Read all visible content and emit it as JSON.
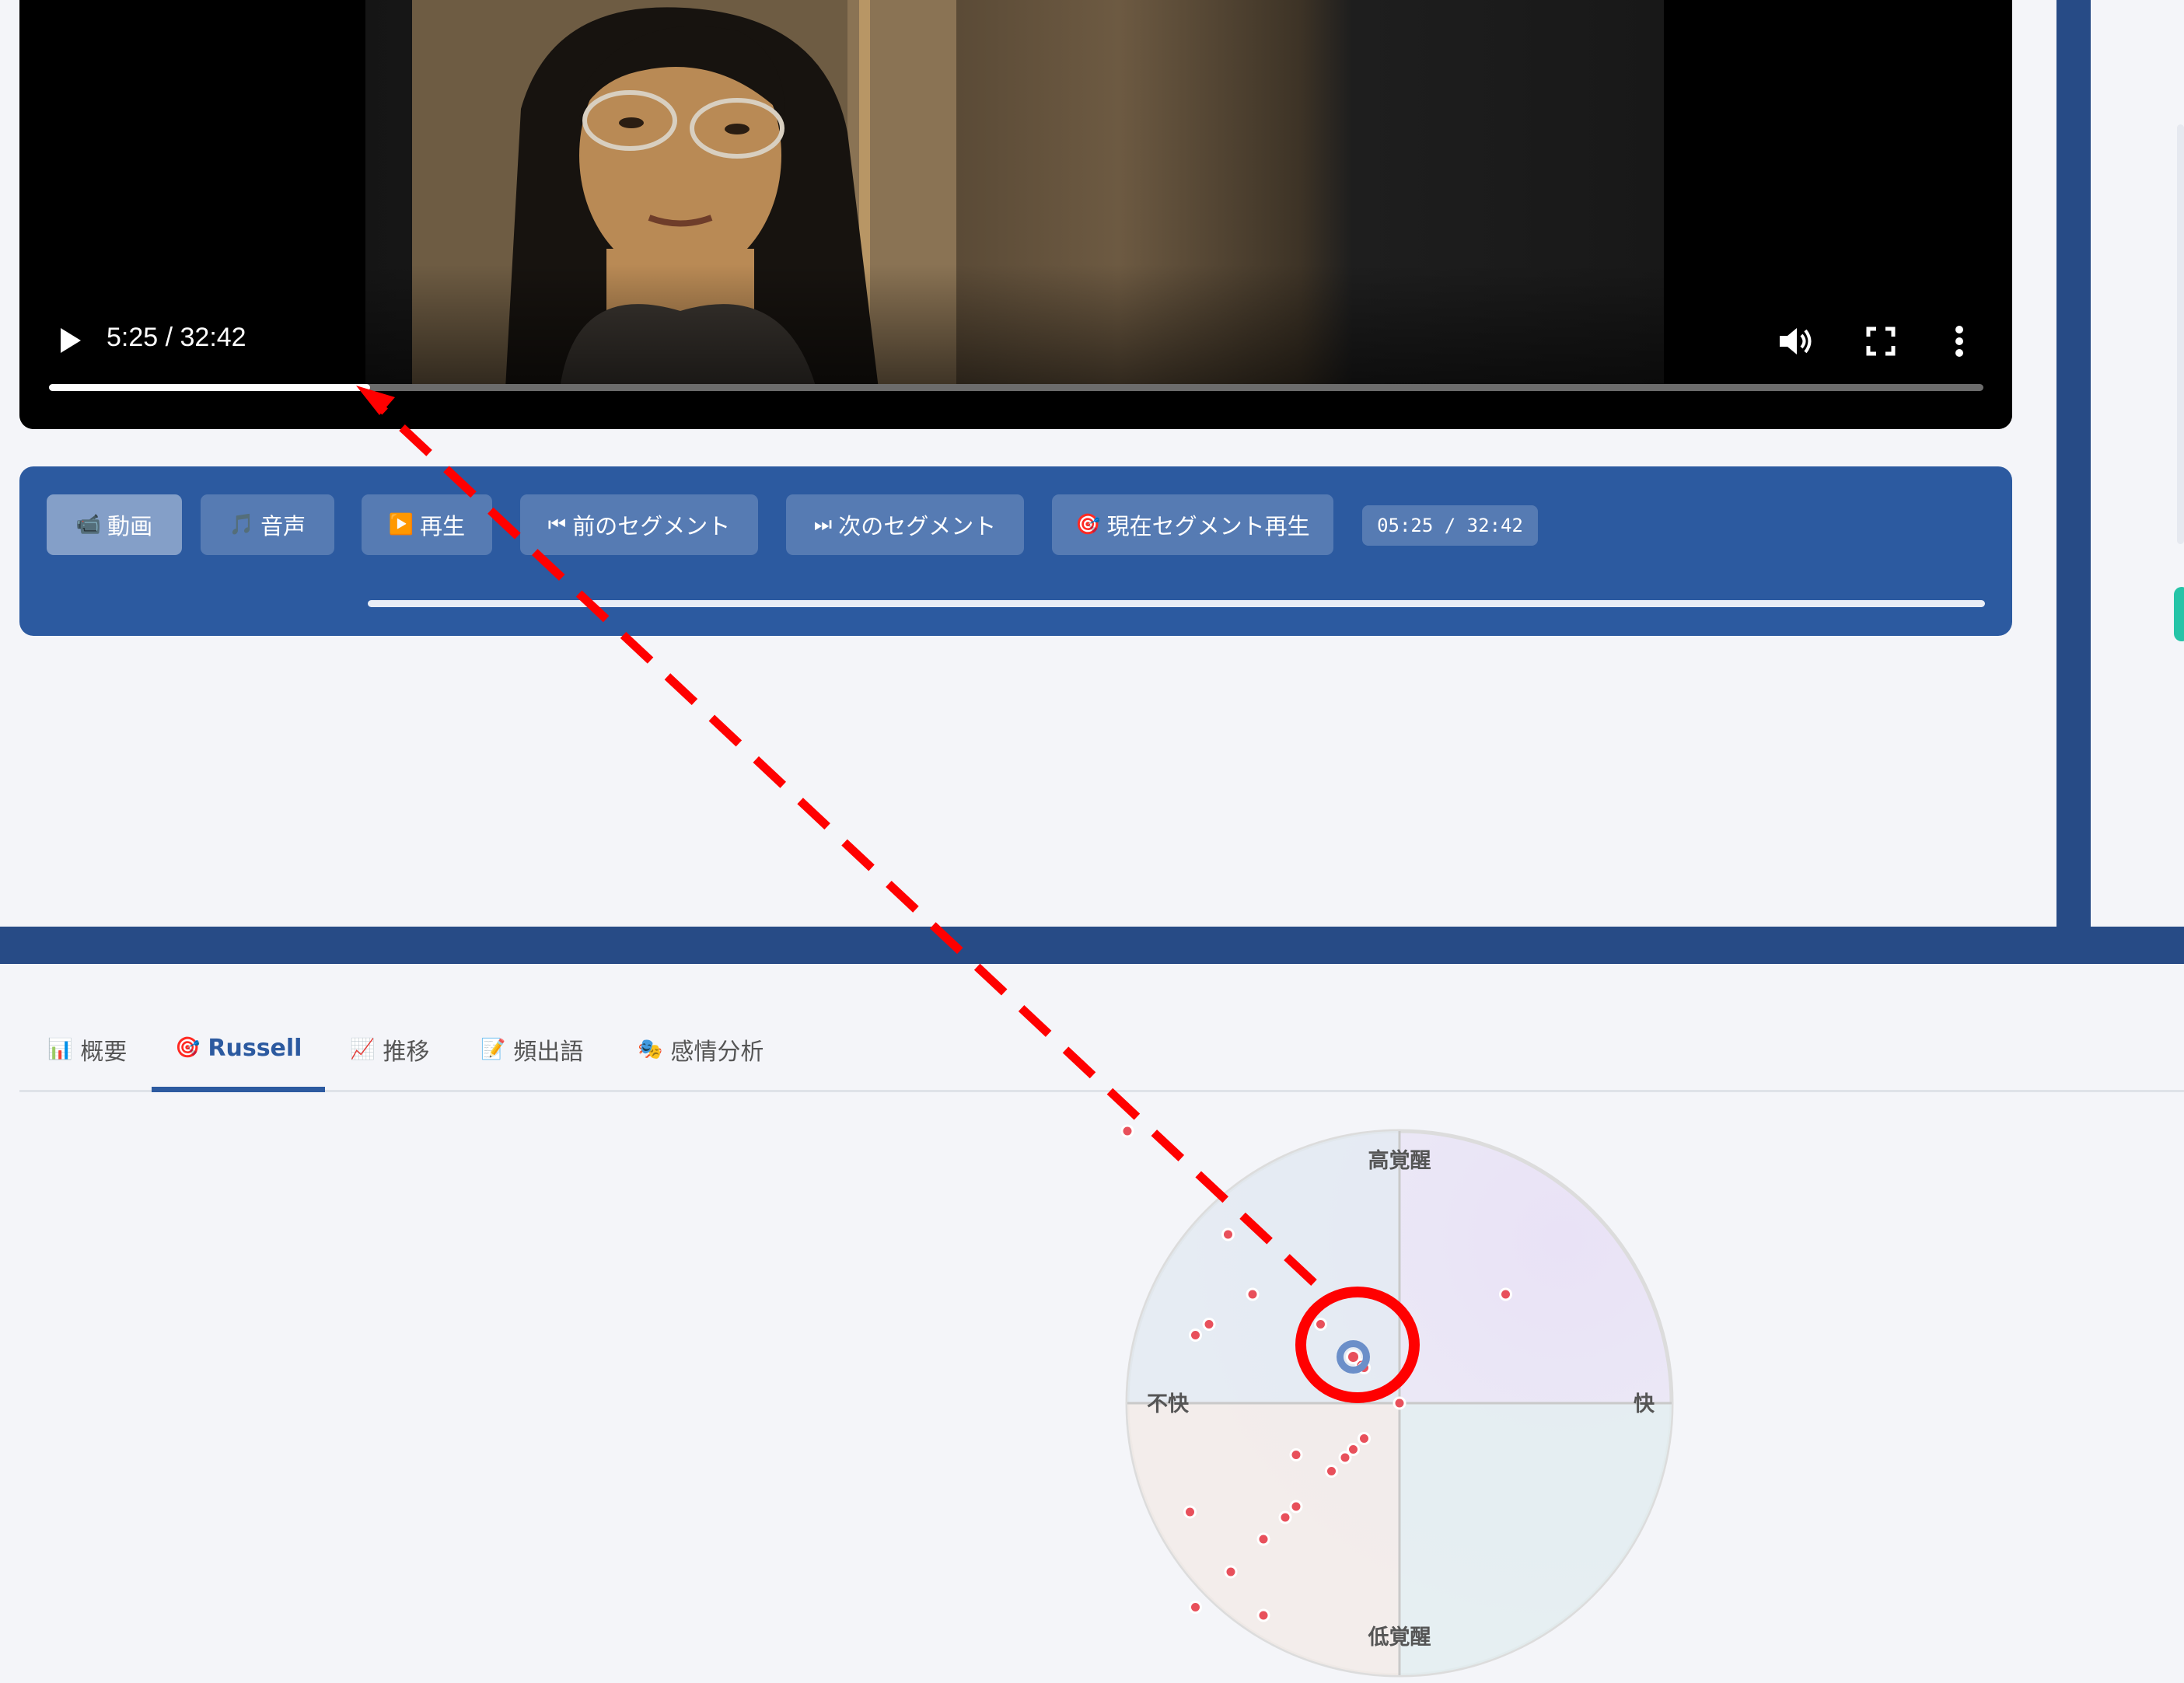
{
  "video": {
    "time_display": "5:25 / 32:42",
    "progress": 0.166,
    "icons": {
      "play": "play-icon",
      "volume": "volume-icon",
      "fullscreen": "fullscreen-icon",
      "more": "more-vert-icon"
    }
  },
  "controls": {
    "video_button": {
      "icon": "📹",
      "label": "動画"
    },
    "audio_button": {
      "icon": "🎵",
      "label": "音声"
    },
    "play_button": {
      "icon": "▶️",
      "label": "再生"
    },
    "prev_segment_button": {
      "icon": "⏮",
      "label": "前のセグメント"
    },
    "next_segment_button": {
      "icon": "⏭",
      "label": "次のセグメント"
    },
    "play_current_segment_button": {
      "icon": "🎯",
      "label": "現在セグメント再生"
    },
    "time_badge": "05:25 / 32:42",
    "segment_progress": 0.166
  },
  "tabs": [
    {
      "icon": "📊",
      "label": "概要",
      "active": false
    },
    {
      "icon": "🎯",
      "label": "Russell",
      "active": true
    },
    {
      "icon": "📈",
      "label": "推移",
      "active": false
    },
    {
      "icon": "📝",
      "label": "頻出語",
      "active": false
    },
    {
      "icon": "🎭",
      "label": "感情分析",
      "active": false
    }
  ],
  "russell": {
    "labels": {
      "top": "高覚醒",
      "bottom": "低覚醒",
      "left": "不快",
      "right": "快"
    },
    "point_color": "#e8505b",
    "current_marker_color": "#6b8fc9",
    "points": [
      [
        -1.0,
        1.0
      ],
      [
        -0.63,
        0.62
      ],
      [
        -0.54,
        0.4
      ],
      [
        -0.7,
        0.29
      ],
      [
        -0.75,
        0.25
      ],
      [
        -0.29,
        0.29
      ],
      [
        0.39,
        0.4
      ],
      [
        -0.14,
        0.14
      ],
      [
        -0.13,
        0.13
      ],
      [
        0.0,
        0.0
      ],
      [
        -0.13,
        -0.13
      ],
      [
        -0.17,
        -0.17
      ],
      [
        -0.2,
        -0.2
      ],
      [
        -0.25,
        -0.25
      ],
      [
        -0.38,
        -0.19
      ],
      [
        -0.38,
        -0.38
      ],
      [
        -0.42,
        -0.42
      ],
      [
        -0.5,
        -0.5
      ],
      [
        -0.77,
        -0.4
      ],
      [
        -0.62,
        -0.62
      ],
      [
        -0.75,
        -0.75
      ],
      [
        -0.5,
        -0.78
      ]
    ],
    "current": [
      -0.17,
      0.17
    ]
  },
  "annotation": {
    "color": "#ff0000"
  },
  "colors": {
    "brand_blue": "#2c5aa0",
    "frame_blue": "#274b86"
  }
}
